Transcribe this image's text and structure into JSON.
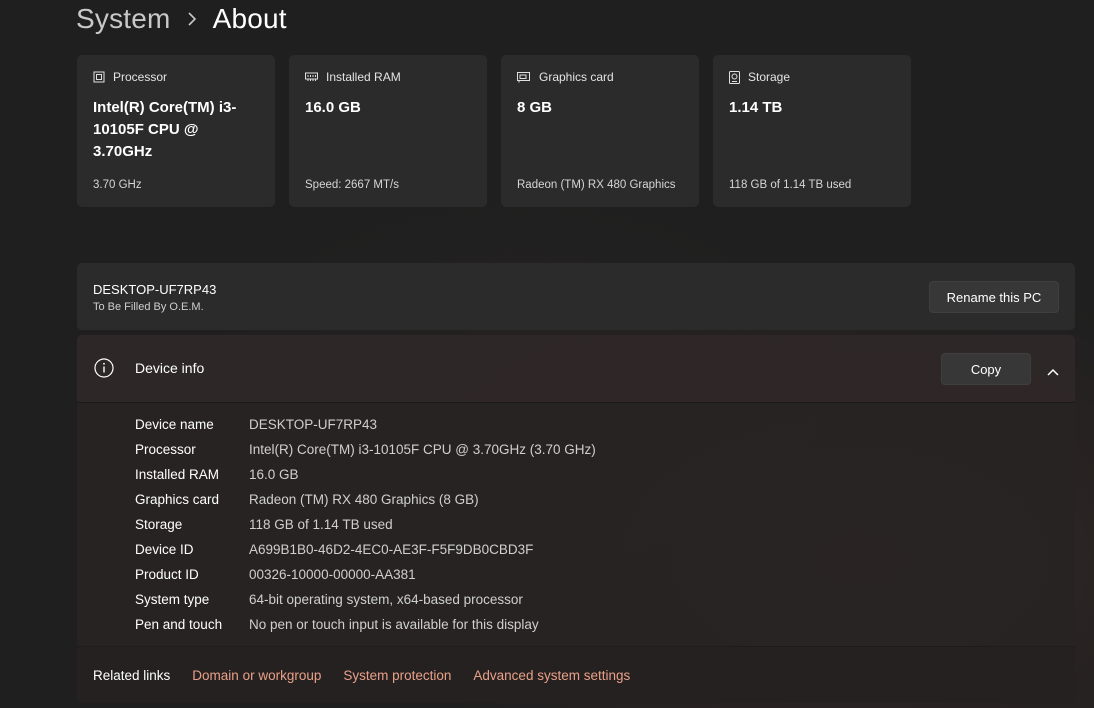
{
  "breadcrumb": {
    "parent": "System",
    "separator_icon": "chevron-right-icon",
    "current": "About"
  },
  "cards": [
    {
      "icon": "processor-icon",
      "title": "Processor",
      "value": "Intel(R) Core(TM) i3-10105F CPU @ 3.70GHz",
      "sub": "3.70 GHz"
    },
    {
      "icon": "ram-icon",
      "title": "Installed RAM",
      "value": "16.0 GB",
      "sub": "Speed: 2667 MT/s"
    },
    {
      "icon": "graphics-card-icon",
      "title": "Graphics card",
      "value": "8 GB",
      "sub": "Radeon (TM) RX 480 Graphics"
    },
    {
      "icon": "storage-icon",
      "title": "Storage",
      "value": "1.14 TB",
      "sub": "118 GB of 1.14 TB used"
    }
  ],
  "pc": {
    "name": "DESKTOP-UF7RP43",
    "oem": "To Be Filled By O.E.M.",
    "rename_label": "Rename this PC"
  },
  "device_info": {
    "icon": "info-icon",
    "title": "Device info",
    "copy_label": "Copy",
    "collapse_icon": "chevron-up-icon",
    "rows": [
      {
        "label": "Device name",
        "value": "DESKTOP-UF7RP43"
      },
      {
        "label": "Processor",
        "value": "Intel(R) Core(TM) i3-10105F CPU @ 3.70GHz (3.70 GHz)"
      },
      {
        "label": "Installed RAM",
        "value": "16.0 GB"
      },
      {
        "label": "Graphics card",
        "value": "Radeon (TM) RX 480 Graphics (8 GB)"
      },
      {
        "label": "Storage",
        "value": "118 GB of 1.14 TB used"
      },
      {
        "label": "Device ID",
        "value": "A699B1B0-46D2-4EC0-AE3F-F5F9DB0CBD3F"
      },
      {
        "label": "Product ID",
        "value": "00326-10000-00000-AA381"
      },
      {
        "label": "System type",
        "value": "64-bit operating system, x64-based processor"
      },
      {
        "label": "Pen and touch",
        "value": "No pen or touch input is available for this display"
      }
    ]
  },
  "related": {
    "title": "Related links",
    "links": [
      "Domain or workgroup",
      "System protection",
      "Advanced system settings"
    ]
  },
  "colors": {
    "background": "#1f1f1f",
    "card": "#2b2b2b",
    "link": "#e9a088",
    "text": "#ffffff",
    "muted_text": "#cfcfcf"
  }
}
